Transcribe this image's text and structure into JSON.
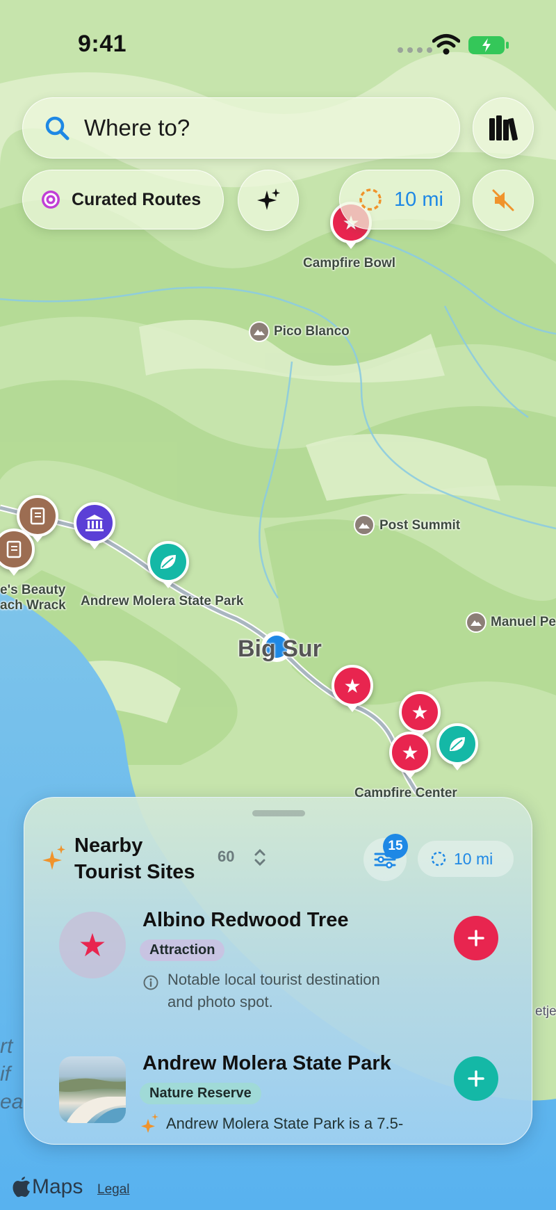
{
  "status_bar": {
    "time": "9:41"
  },
  "search": {
    "placeholder_text": "Where to?"
  },
  "controls": {
    "curated_routes_label": "Curated Routes",
    "radius_label": "10 mi"
  },
  "map_labels": {
    "campfire_bowl": "Campfire Bowl",
    "pico_blanco": "Pico Blanco",
    "post_summit": "Post Summit",
    "manuel_peak": "Manuel Pe",
    "andrew_molera": "Andrew Molera State Park",
    "beauty": "e's Beauty",
    "wrack": "ach Wrack",
    "big_sur": "Big Sur",
    "campfire_center": "Campfire Center",
    "edge_right": "etjen",
    "ocean_partial_1": "rt",
    "ocean_partial_2": "if",
    "ocean_partial_3": "ea"
  },
  "sheet": {
    "title_line1": "Nearby",
    "title_line2": "Tourist Sites",
    "count": "60",
    "filter_badge": "15",
    "radius_label": "10 mi",
    "items": [
      {
        "name": "Albino Redwood Tree",
        "category": "Attraction",
        "description_line1": "Notable local tourist destination",
        "description_line2": "and photo spot."
      },
      {
        "name": "Andrew Molera State Park",
        "category": "Nature Reserve",
        "description_line1": "Andrew Molera State Park is a 7.5-"
      }
    ]
  },
  "footer": {
    "brand": "Maps",
    "legal": "Legal"
  },
  "colors": {
    "accent_blue": "#1e88e5",
    "attraction_red": "#e8254f",
    "nature_teal": "#14b8a6",
    "museum_purple": "#5b3fd6",
    "book_brown": "#9c6d52",
    "orange_radius": "#f0932b"
  }
}
